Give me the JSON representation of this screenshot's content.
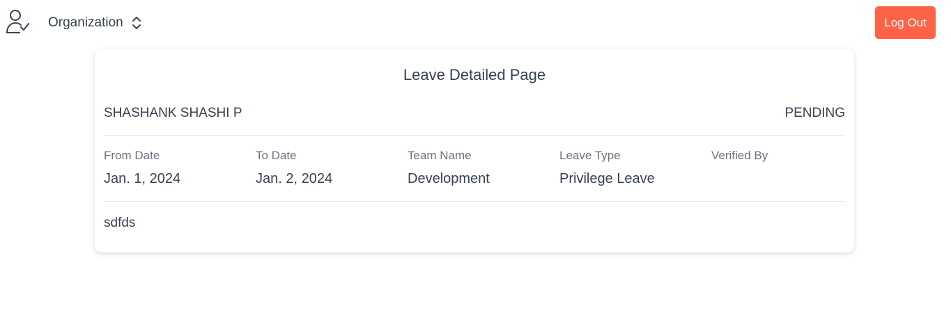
{
  "header": {
    "org_label": "Organization",
    "logout_label": "Log Out",
    "user_icon": "user-check-icon",
    "switch_icon": "chevron-up-down-icon",
    "logout_color": "#ff6347"
  },
  "leave": {
    "title": "Leave Detailed Page",
    "employee_name": "SHASHANK SHASHI P",
    "status": "PENDING",
    "fields": [
      {
        "label": "From Date",
        "value": "Jan. 1, 2024"
      },
      {
        "label": "To Date",
        "value": "Jan. 2, 2024"
      },
      {
        "label": "Team Name",
        "value": "Development"
      },
      {
        "label": "Leave Type",
        "value": "Privilege Leave"
      },
      {
        "label": "Verified By",
        "value": ""
      }
    ],
    "reason": "sdfds"
  }
}
